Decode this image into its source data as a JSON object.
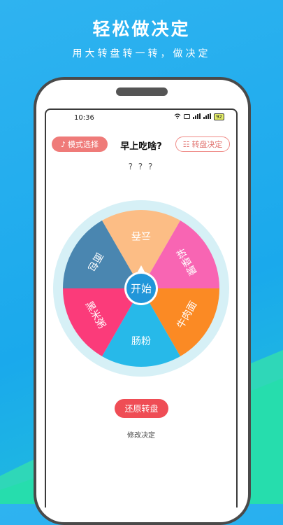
{
  "promo": {
    "title": "轻松做决定",
    "subtitle": "用大转盘转一转，做决定"
  },
  "status_bar": {
    "time": "10:36",
    "battery": "92"
  },
  "header": {
    "mode_button_label": "模式选择",
    "title": "早上吃啥?",
    "decide_button_label": "转盘决定"
  },
  "result_text": "? ? ?",
  "wheel": {
    "center_label": "开始",
    "segments": [
      {
        "label": "云吞",
        "color": "#fcbd85"
      },
      {
        "label": "酱香饼",
        "color": "#f865b3"
      },
      {
        "label": "牛肉面",
        "color": "#fb8a24"
      },
      {
        "label": "肠粉",
        "color": "#27b9e9"
      },
      {
        "label": "黑米粥",
        "color": "#fb3b7a"
      },
      {
        "label": "面包",
        "color": "#4a86b0"
      }
    ],
    "rim_color": "#d6f0f6",
    "center_color": "#2196d9"
  },
  "reset_button_label": "还原转盘",
  "modify_link_label": "修改决定"
}
